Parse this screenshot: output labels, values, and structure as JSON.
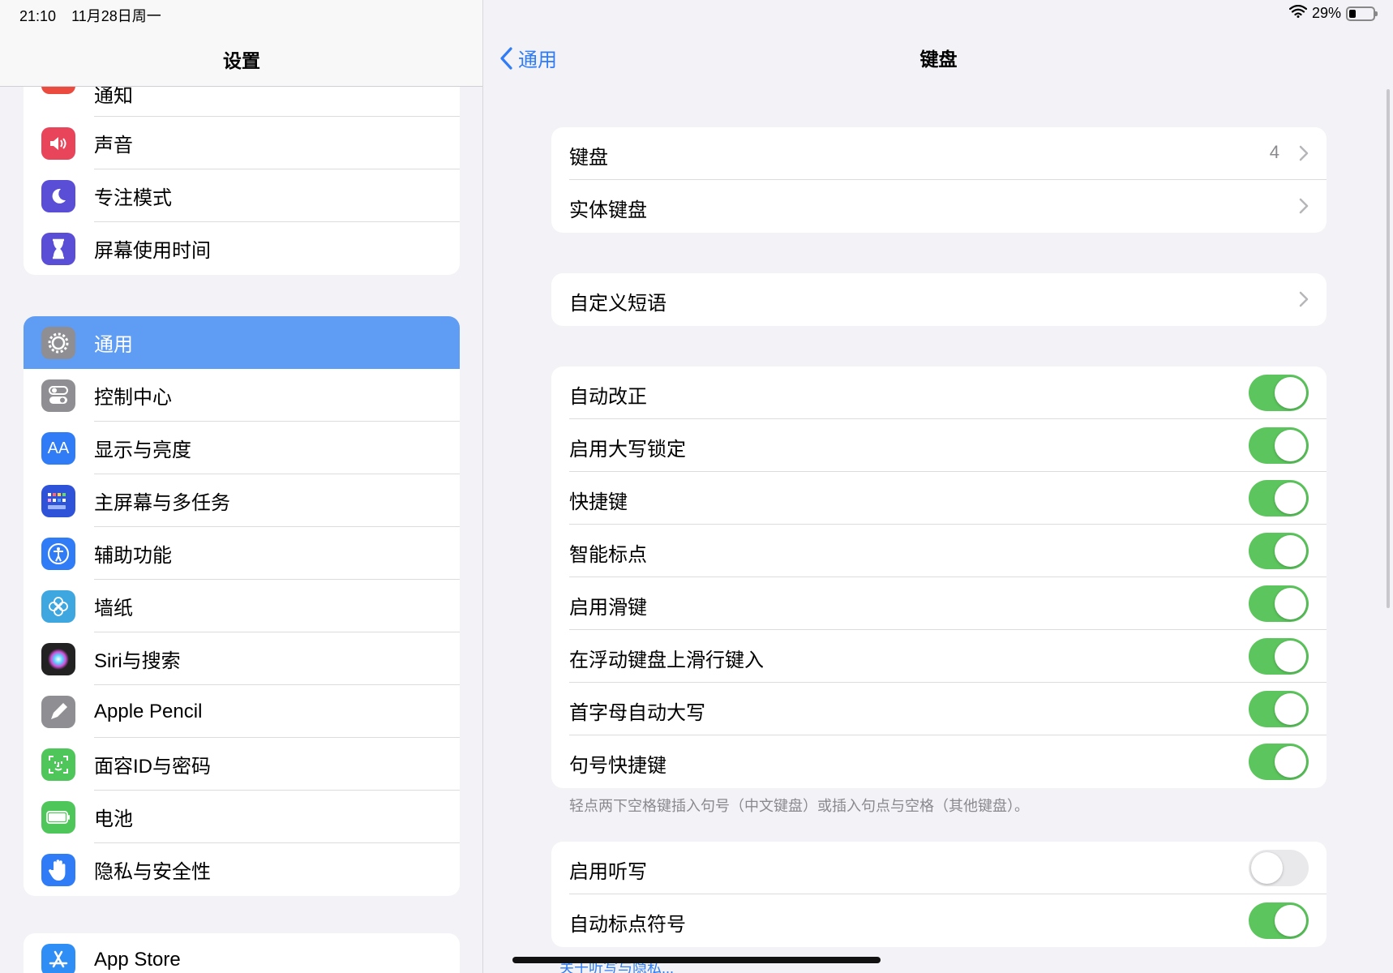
{
  "status_bar": {
    "time": "21:10",
    "date": "11月28日周一",
    "battery": "29%",
    "battery_level": 0.29
  },
  "sidebar": {
    "title": "设置",
    "group1": [
      {
        "label": "通知",
        "icon": "bell-icon",
        "color": "#eb4b3f"
      },
      {
        "label": "声音",
        "icon": "speaker-icon",
        "color": "#e8445a"
      },
      {
        "label": "专注模式",
        "icon": "moon-icon",
        "color": "#5a4ed6"
      },
      {
        "label": "屏幕使用时间",
        "icon": "hourglass-icon",
        "color": "#5a4ed6"
      }
    ],
    "group2": [
      {
        "label": "通用",
        "icon": "gear-icon",
        "color": "#8e8e93",
        "selected": true
      },
      {
        "label": "控制中心",
        "icon": "toggles-icon",
        "color": "#8e8e93"
      },
      {
        "label": "显示与亮度",
        "icon": "text-size-icon",
        "color": "#2f7cf6"
      },
      {
        "label": "主屏幕与多任务",
        "icon": "app-grid-icon",
        "color": "#2f53d8"
      },
      {
        "label": "辅助功能",
        "icon": "accessibility-icon",
        "color": "#2f7cf6"
      },
      {
        "label": "墙纸",
        "icon": "flower-icon",
        "color": "#3ea7df"
      },
      {
        "label": "Siri与搜索",
        "icon": "siri-icon",
        "color": "#222222"
      },
      {
        "label": "Apple Pencil",
        "icon": "pencil-icon",
        "color": "#8e8e93"
      },
      {
        "label": "面容ID与密码",
        "icon": "face-id-icon",
        "color": "#4ec65a"
      },
      {
        "label": "电池",
        "icon": "battery-icon",
        "color": "#4ec65a"
      },
      {
        "label": "隐私与安全性",
        "icon": "hand-icon",
        "color": "#2f7cf6"
      }
    ],
    "group3": [
      {
        "label": "App Store",
        "icon": "app-store-icon",
        "color": "#2f8ef6"
      }
    ]
  },
  "main": {
    "back_label": "通用",
    "title": "键盘",
    "card1": [
      {
        "label": "键盘",
        "detail": "4"
      },
      {
        "label": "实体键盘",
        "detail": ""
      }
    ],
    "card2": [
      {
        "label": "自定义短语"
      }
    ],
    "card3": [
      {
        "label": "自动改正",
        "on": true
      },
      {
        "label": "启用大写锁定",
        "on": true
      },
      {
        "label": "快捷键",
        "on": true
      },
      {
        "label": "智能标点",
        "on": true
      },
      {
        "label": "启用滑键",
        "on": true
      },
      {
        "label": "在浮动键盘上滑行键入",
        "on": true
      },
      {
        "label": "首字母自动大写",
        "on": true
      },
      {
        "label": "句号快捷键",
        "on": true
      }
    ],
    "footnote": "轻点两下空格键插入句号（中文键盘）或插入句点与空格（其他键盘）。",
    "card4": [
      {
        "label": "启用听写",
        "on": false
      },
      {
        "label": "自动标点符号",
        "on": true
      }
    ],
    "link_partial": "关于听写与隐私..."
  },
  "colors": {
    "accent": "#2f7cf6",
    "toggle_on": "#5cc55d",
    "selected_row": "#5f9cf3"
  }
}
